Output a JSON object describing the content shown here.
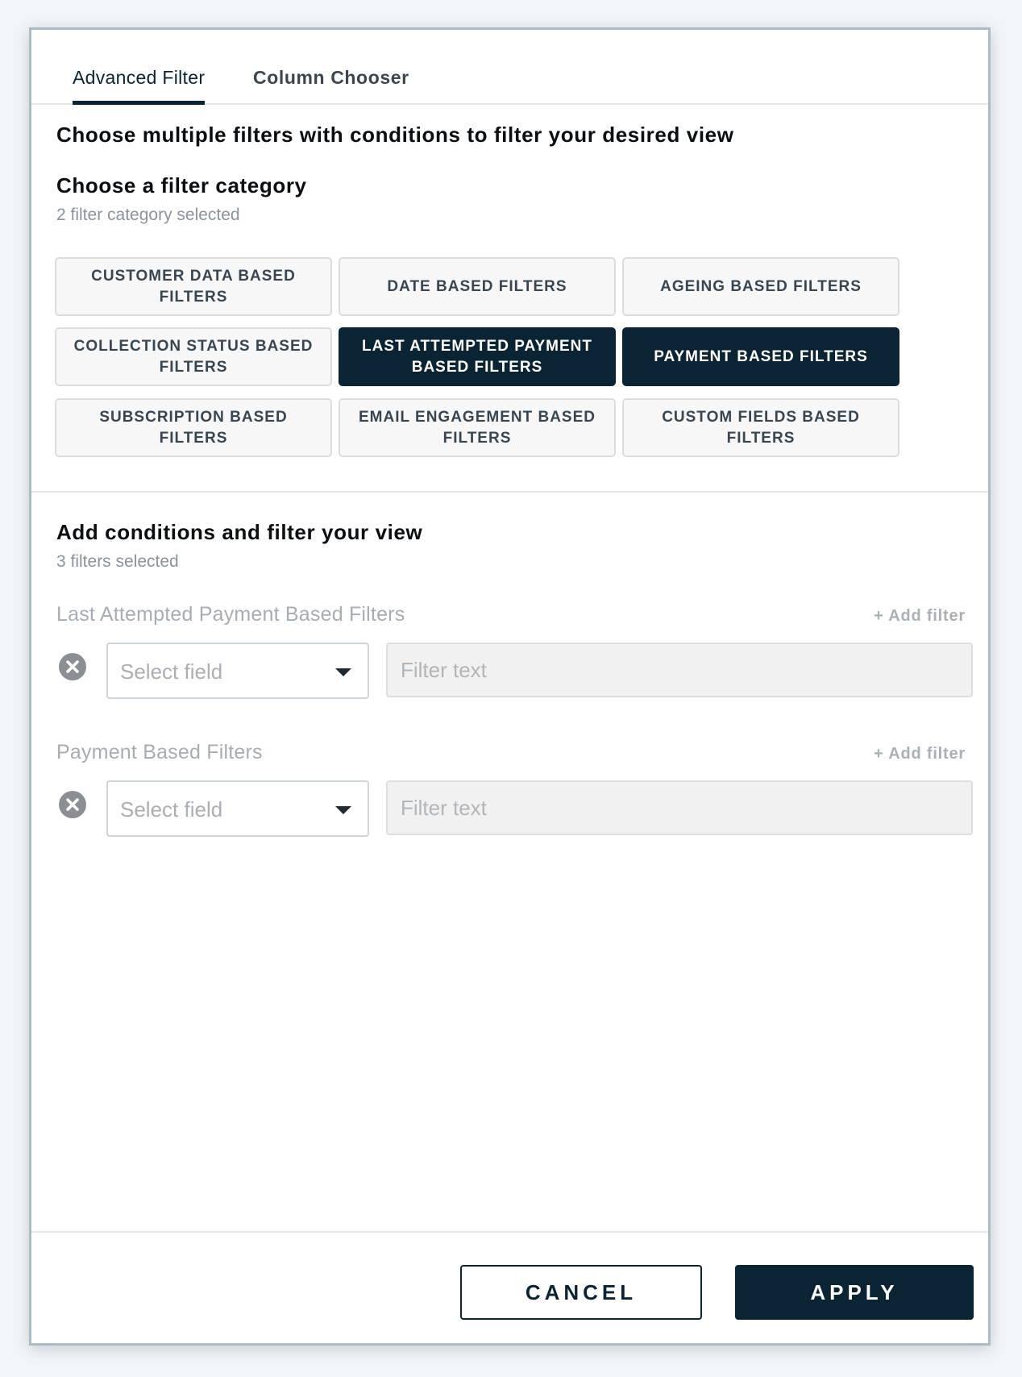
{
  "tabs": [
    {
      "label": "Advanced Filter",
      "active": true
    },
    {
      "label": "Column Chooser",
      "active": false
    }
  ],
  "intro": "Choose multiple filters with conditions to filter your desired view",
  "category": {
    "title": "Choose a filter category",
    "selected_count_text": "2 filter category selected",
    "buttons": [
      {
        "label": "CUSTOMER DATA BASED FILTERS",
        "selected": false
      },
      {
        "label": "DATE BASED FILTERS",
        "selected": false
      },
      {
        "label": "AGEING BASED FILTERS",
        "selected": false
      },
      {
        "label": "COLLECTION STATUS BASED FILTERS",
        "selected": false
      },
      {
        "label": "LAST ATTEMPTED PAYMENT BASED FILTERS",
        "selected": true
      },
      {
        "label": "PAYMENT BASED FILTERS",
        "selected": true
      },
      {
        "label": "SUBSCRIPTION BASED FILTERS",
        "selected": false
      },
      {
        "label": "EMAIL ENGAGEMENT BASED FILTERS",
        "selected": false
      },
      {
        "label": "CUSTOM FIELDS BASED FILTERS",
        "selected": false
      }
    ]
  },
  "conditions": {
    "title": "Add conditions and filter your view",
    "selected_count_text": "3 filters selected",
    "groups": [
      {
        "label": "Last Attempted Payment Based Filters",
        "add_filter": "+ Add filter",
        "row": {
          "select_placeholder": "Select field",
          "text_placeholder": "Filter text"
        }
      },
      {
        "label": "Payment Based Filters",
        "add_filter": "+ Add filter",
        "row": {
          "select_placeholder": "Select field",
          "text_placeholder": "Filter text"
        }
      }
    ]
  },
  "footer": {
    "cancel_label": "CANCEL",
    "apply_label": "APPLY"
  },
  "colors": {
    "primary": "#0b2433",
    "muted": "#8a949b",
    "frame": "#a9bcc8"
  }
}
